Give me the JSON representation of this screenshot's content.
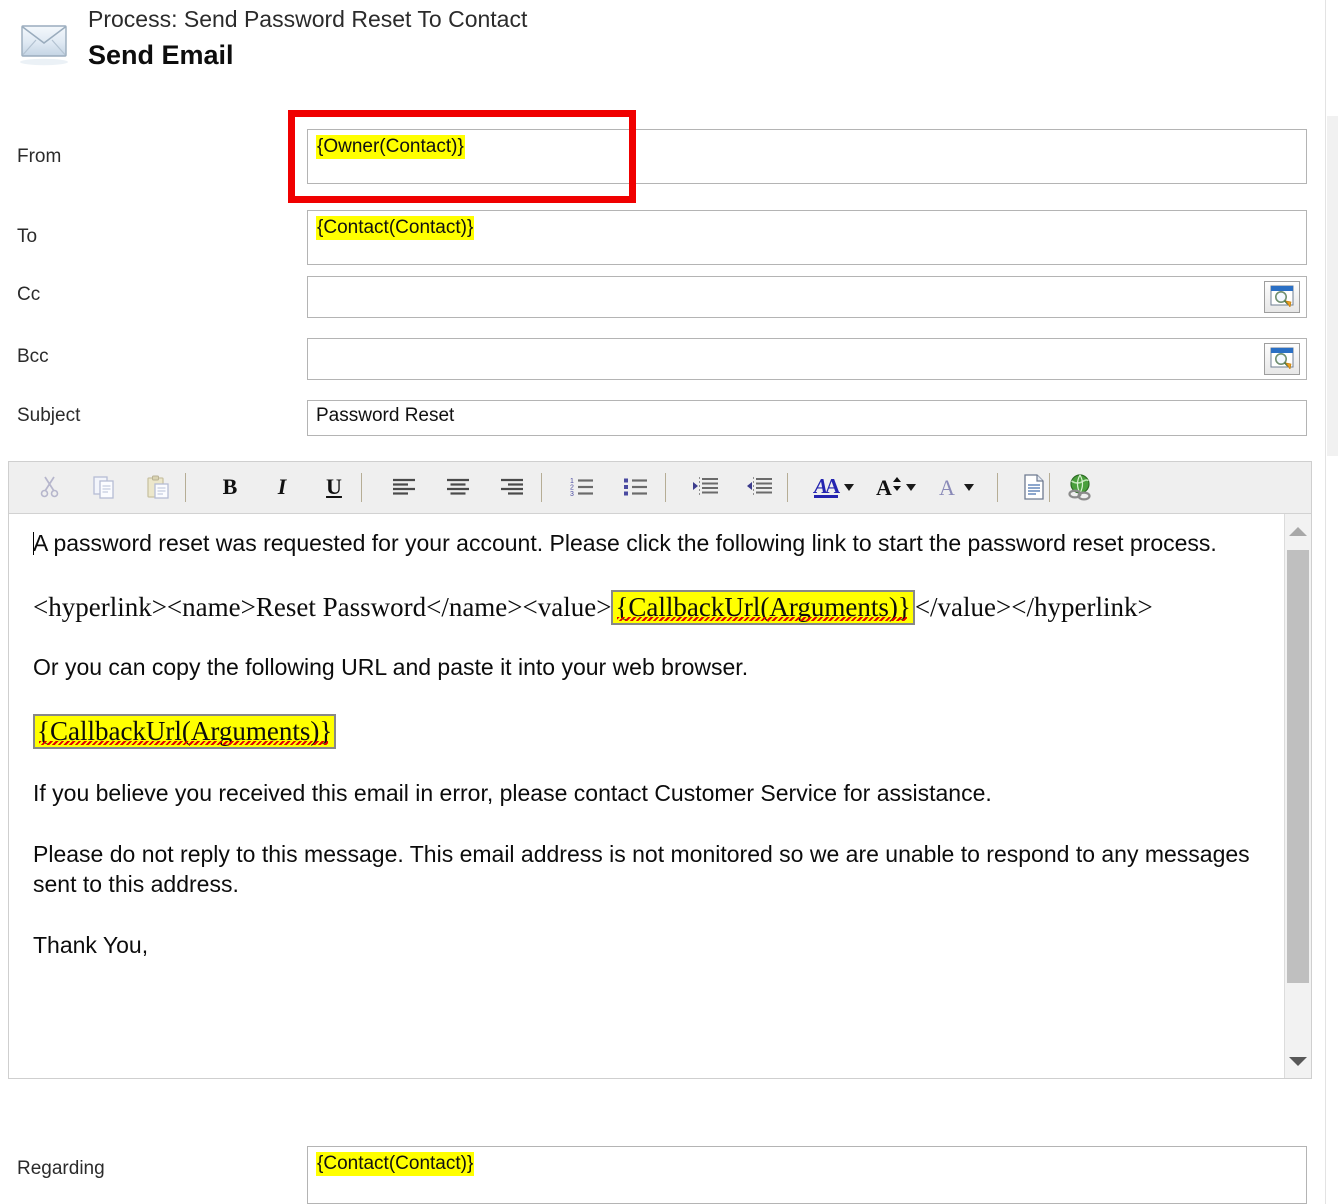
{
  "header": {
    "icon": "envelope-icon",
    "process_line": "Process: Send Password Reset To Contact",
    "title": "Send Email"
  },
  "form": {
    "fields": [
      {
        "label": "From",
        "value": "{Owner(Contact)}",
        "highlighted": true,
        "lookup": false,
        "annotated": true
      },
      {
        "label": "To",
        "value": "{Contact(Contact)}",
        "highlighted": true,
        "lookup": false,
        "annotated": false
      },
      {
        "label": "Cc",
        "value": "",
        "highlighted": false,
        "lookup": true,
        "annotated": false
      },
      {
        "label": "Bcc",
        "value": "",
        "highlighted": false,
        "lookup": true,
        "annotated": false
      },
      {
        "label": "Subject",
        "value": "Password Reset",
        "highlighted": false,
        "lookup": false,
        "annotated": false
      }
    ],
    "regarding": {
      "label": "Regarding",
      "value": "{Contact(Contact)}",
      "highlighted": true
    }
  },
  "annotation": {
    "color": "#f00000",
    "target": "From"
  },
  "editor": {
    "toolbar": [
      {
        "name": "cut-button",
        "glyph": "cut",
        "disabled": true
      },
      {
        "name": "copy-button",
        "glyph": "copy",
        "disabled": true
      },
      {
        "name": "paste-button",
        "glyph": "paste",
        "disabled": true
      },
      {
        "name": "bold-button",
        "glyph": "B",
        "disabled": false
      },
      {
        "name": "italic-button",
        "glyph": "I",
        "disabled": false
      },
      {
        "name": "underline-button",
        "glyph": "U",
        "disabled": false
      },
      {
        "name": "align-left-button",
        "glyph": "align-left",
        "disabled": false
      },
      {
        "name": "align-center-button",
        "glyph": "align-center",
        "disabled": false
      },
      {
        "name": "align-right-button",
        "glyph": "align-right",
        "disabled": false
      },
      {
        "name": "numbered-list-button",
        "glyph": "ordered-list",
        "disabled": false
      },
      {
        "name": "bulleted-list-button",
        "glyph": "bullet-list",
        "disabled": false
      },
      {
        "name": "increase-indent-button",
        "glyph": "indent-inc",
        "disabled": false
      },
      {
        "name": "decrease-indent-button",
        "glyph": "indent-dec",
        "disabled": false
      },
      {
        "name": "font-color-button",
        "glyph": "font-color",
        "disabled": false
      },
      {
        "name": "font-size-button",
        "glyph": "font-size",
        "disabled": false
      },
      {
        "name": "font-name-button",
        "glyph": "font-name",
        "disabled": true
      },
      {
        "name": "insert-template-button",
        "glyph": "template",
        "disabled": false
      },
      {
        "name": "insert-hyperlink-button",
        "glyph": "hyperlink",
        "disabled": false
      }
    ],
    "body": {
      "p1": "A password reset was requested for your account. Please click the following link to start the password reset process.",
      "p2_prefix": "<hyperlink><name>Reset Password</name><value>",
      "p2_token": "{CallbackUrl(Arguments)}",
      "p2_suffix": "</value></hyperlink>",
      "p3": "Or you can copy the following URL and paste it into your web browser.",
      "p4_token": "{CallbackUrl(Arguments)}",
      "p5": "If you believe you received this email in error, please contact Customer Service for assistance.",
      "p6": "Please do not reply to this message. This email address is not monitored so we are unable to respond to any messages sent to this address.",
      "p7": "Thank You,"
    }
  },
  "colors": {
    "highlight": "#ffff00",
    "annotation": "#f00000",
    "toolbar_bg": "#efefef",
    "field_border": "#b4b4b4"
  }
}
